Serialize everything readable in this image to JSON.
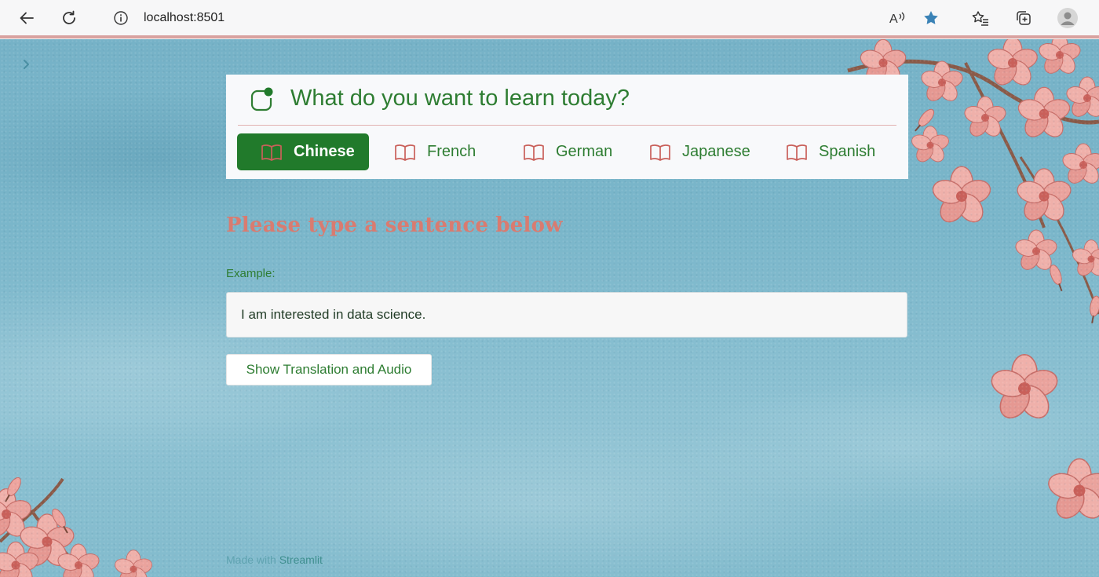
{
  "browser": {
    "url": "localhost:8501",
    "icons": [
      "back-arrow-icon",
      "refresh-icon",
      "info-icon",
      "read-aloud-icon",
      "favorite-star-icon",
      "favorites-list-icon",
      "collections-icon",
      "profile-icon"
    ]
  },
  "menu": {
    "title": "What do you want to learn today?",
    "options": [
      {
        "label": "Chinese",
        "active": true
      },
      {
        "label": "French",
        "active": false
      },
      {
        "label": "German",
        "active": false
      },
      {
        "label": "Japanese",
        "active": false
      },
      {
        "label": "Spanish",
        "active": false
      }
    ]
  },
  "main": {
    "heading": "Please type a sentence below",
    "input_label": "Example:",
    "input_value": "I am interested in data science.",
    "button_label": "Show Translation and Audio"
  },
  "footer": {
    "prefix": "Made with ",
    "brand": "Streamlit"
  },
  "colors": {
    "accent_green": "#217a2b",
    "text_green": "#2e7d32",
    "heading_coral": "#d97b70",
    "background_blue": "#7ab6ca",
    "blossom_pink": "#e8a09a"
  }
}
